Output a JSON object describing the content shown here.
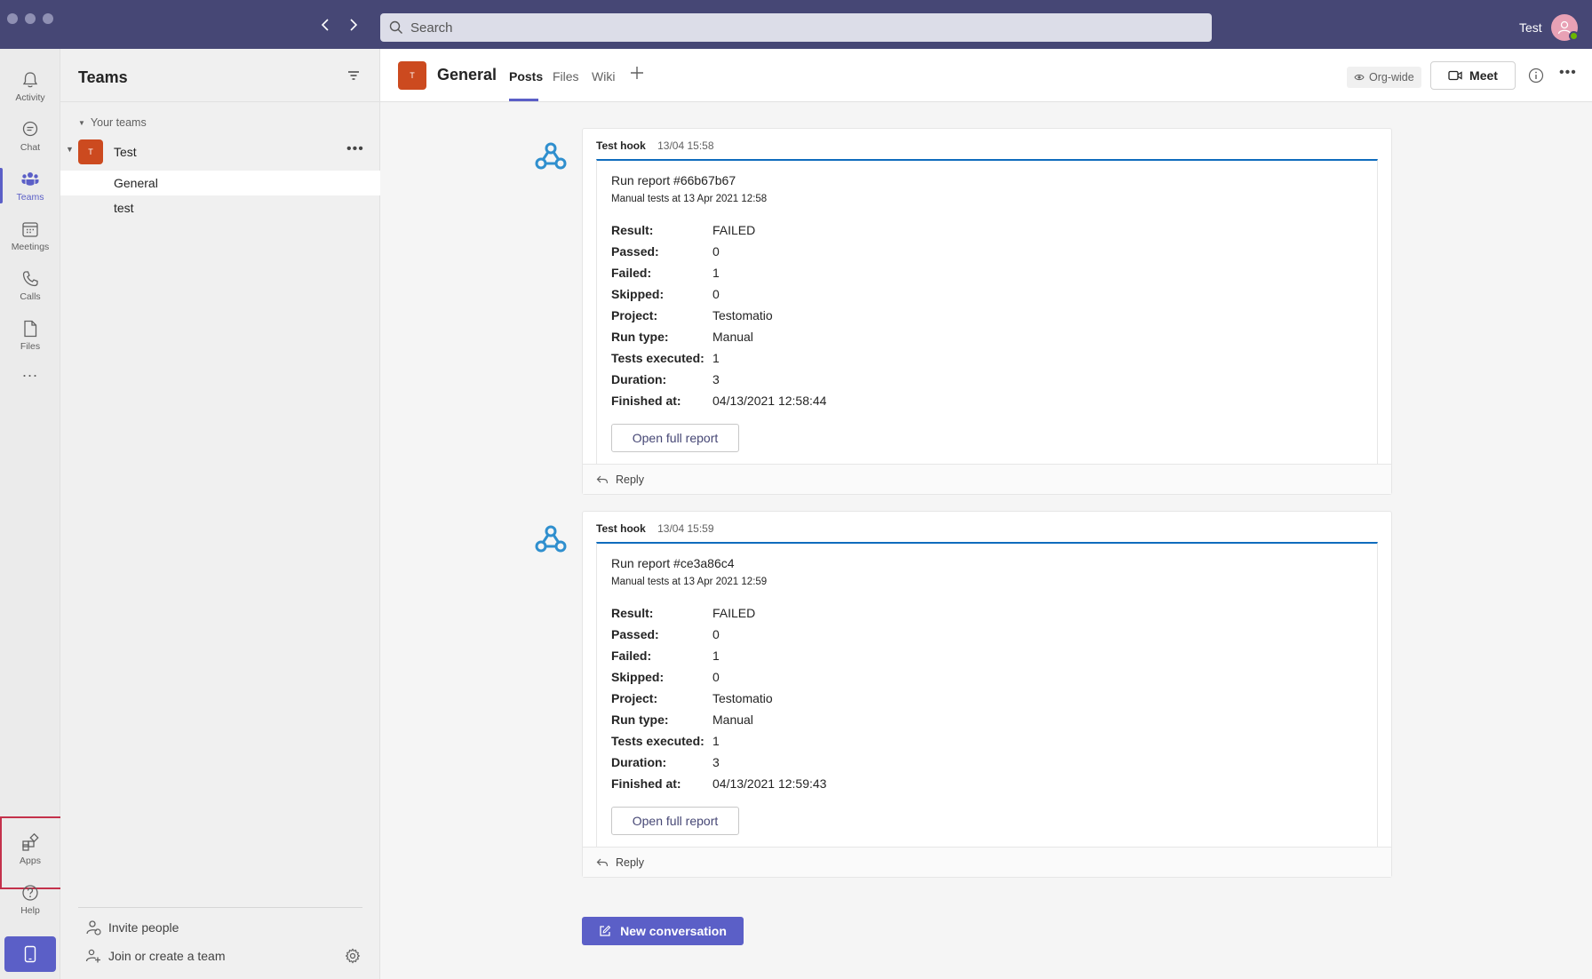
{
  "titlebar": {
    "search_placeholder": "Search",
    "user_name": "Test"
  },
  "appbar": {
    "items": [
      {
        "label": "Activity",
        "icon": "bell-icon"
      },
      {
        "label": "Chat",
        "icon": "chat-icon"
      },
      {
        "label": "Teams",
        "icon": "teams-icon",
        "active": true
      },
      {
        "label": "Meetings",
        "icon": "calendar-icon"
      },
      {
        "label": "Calls",
        "icon": "phone-icon"
      },
      {
        "label": "Files",
        "icon": "file-icon"
      },
      {
        "label": "Apps",
        "icon": "apps-icon"
      },
      {
        "label": "Help",
        "icon": "help-icon"
      }
    ],
    "more": "..."
  },
  "teams_panel": {
    "title": "Teams",
    "section": "Your teams",
    "team": {
      "name": "Test",
      "initial": "T"
    },
    "channels": [
      "General",
      "test"
    ],
    "footer": {
      "invite": "Invite people",
      "join": "Join or create a team"
    }
  },
  "channel_header": {
    "initial": "T",
    "name": "General",
    "tabs": [
      "Posts",
      "Files",
      "Wiki"
    ],
    "org_wide": "Org-wide",
    "meet": "Meet"
  },
  "messages": [
    {
      "sender": "Test hook",
      "time": "13/04 15:58",
      "title": "Run report #66b67b67",
      "subtitle": "Manual tests at 13 Apr 2021 12:58",
      "facts": [
        {
          "k": "Result:",
          "v": "FAILED"
        },
        {
          "k": "Passed:",
          "v": "0"
        },
        {
          "k": "Failed:",
          "v": "1"
        },
        {
          "k": "Skipped:",
          "v": "0"
        },
        {
          "k": "Project:",
          "v": "Testomatio"
        },
        {
          "k": "Run type:",
          "v": "Manual"
        },
        {
          "k": "Tests executed:",
          "v": "1"
        },
        {
          "k": "Duration:",
          "v": "3"
        },
        {
          "k": "Finished at:",
          "v": "04/13/2021 12:58:44"
        }
      ],
      "button": "Open full report",
      "reply": "Reply"
    },
    {
      "sender": "Test hook",
      "time": "13/04 15:59",
      "title": "Run report #ce3a86c4",
      "subtitle": "Manual tests at 13 Apr 2021 12:59",
      "facts": [
        {
          "k": "Result:",
          "v": "FAILED"
        },
        {
          "k": "Passed:",
          "v": "0"
        },
        {
          "k": "Failed:",
          "v": "1"
        },
        {
          "k": "Skipped:",
          "v": "0"
        },
        {
          "k": "Project:",
          "v": "Testomatio"
        },
        {
          "k": "Run type:",
          "v": "Manual"
        },
        {
          "k": "Tests executed:",
          "v": "1"
        },
        {
          "k": "Duration:",
          "v": "3"
        },
        {
          "k": "Finished at:",
          "v": "04/13/2021 12:59:43"
        }
      ],
      "button": "Open full report",
      "reply": "Reply"
    }
  ],
  "new_conversation": "New conversation",
  "colors": {
    "titlebar": "#464775",
    "accent": "#5b5fc7",
    "team_logo": "#cc4a1f",
    "card_accent": "#0f6cbd",
    "highlight": "#c4314b"
  }
}
